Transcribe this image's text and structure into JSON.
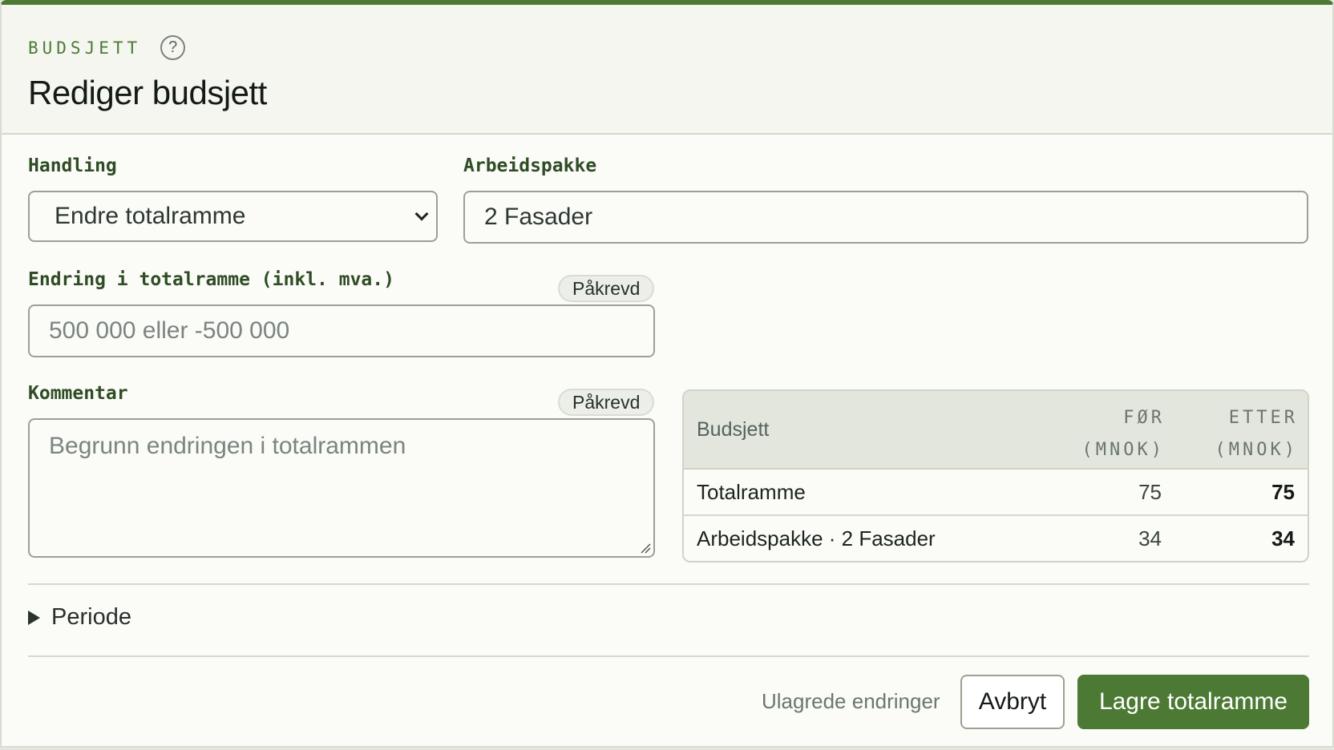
{
  "header": {
    "eyebrow": "BUDSJETT",
    "help_icon": "?",
    "title": "Rediger budsjett"
  },
  "form": {
    "handling": {
      "label": "Handling",
      "value": "Endre totalramme"
    },
    "arbeidspakke": {
      "label": "Arbeidspakke",
      "value": "2 Fasader"
    },
    "endring": {
      "label": "Endring i totalramme (inkl. mva.)",
      "badge": "Påkrevd",
      "placeholder": "500 000 eller -500 000"
    },
    "kommentar": {
      "label": "Kommentar",
      "badge": "Påkrevd",
      "placeholder": "Begrunn endringen i totalrammen"
    }
  },
  "budget_table": {
    "headers": {
      "name": "Budsjett",
      "before_line1": "FØR",
      "before_line2": "(MNOK)",
      "after_line1": "ETTER",
      "after_line2": "(MNOK)"
    },
    "rows": [
      {
        "name": "Totalramme",
        "before": "75",
        "after": "75"
      },
      {
        "name": "Arbeidspakke · 2 Fasader",
        "before": "34",
        "after": "34"
      }
    ]
  },
  "periode": {
    "label": "Periode"
  },
  "footer": {
    "status": "Ulagrede endringer",
    "cancel_label": "Avbryt",
    "save_label": "Lagre totalramme"
  },
  "colors": {
    "accent": "#4c7a34",
    "label": "#2f4d25",
    "background": "#fbfbf7"
  },
  "icons": {
    "help": "help-icon",
    "select": "chevron-down-icon",
    "disclosure": "triangle-right-icon"
  }
}
